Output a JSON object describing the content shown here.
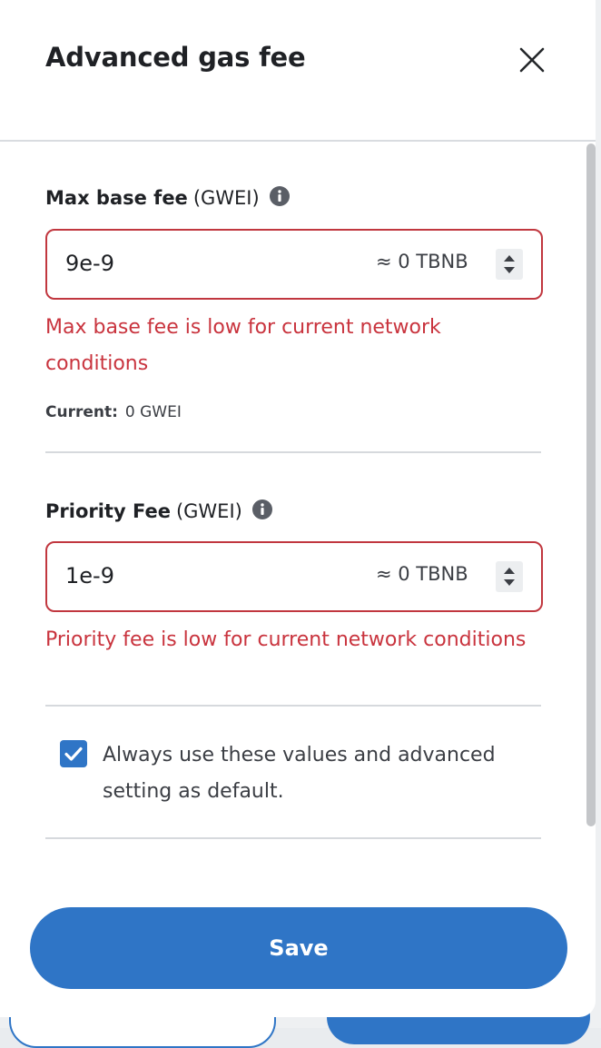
{
  "header": {
    "title": "Advanced gas fee"
  },
  "max_base_fee": {
    "label": "Max base fee",
    "unit": "(GWEI)",
    "value": "9e-9",
    "conversion": "≈ 0 TBNB",
    "error": "Max base fee is low for current network conditions",
    "current_label": "Current:",
    "current_value": "0 GWEI"
  },
  "priority_fee": {
    "label": "Priority Fee",
    "unit": "(GWEI)",
    "value": "1e-9",
    "conversion": "≈ 0 TBNB",
    "error": "Priority fee is low for current network conditions"
  },
  "default_setting": {
    "checked": true,
    "label": "Always use these values and advanced setting as default."
  },
  "footer": {
    "save_label": "Save"
  },
  "colors": {
    "accent": "#2f75c6",
    "error": "#c9343e",
    "error_border": "#c1373f"
  }
}
